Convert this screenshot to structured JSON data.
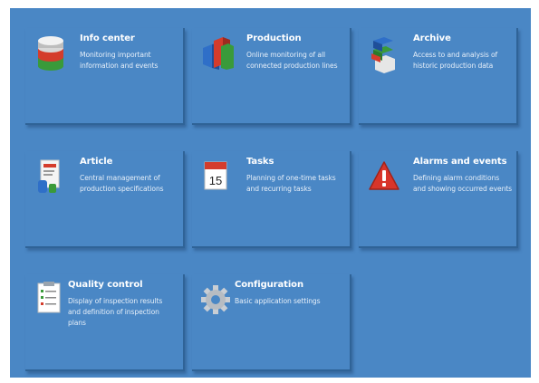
{
  "tiles": [
    {
      "id": "info-center",
      "title": "Info center",
      "desc": [
        "Monitoring important",
        "information and events"
      ],
      "icon": "database-icon"
    },
    {
      "id": "production",
      "title": "Production",
      "desc": [
        "Online monitoring of all",
        "connected production lines"
      ],
      "icon": "production-blocks-icon"
    },
    {
      "id": "archive",
      "title": "Archive",
      "desc": [
        "Access to and analysis of",
        "historic production data"
      ],
      "icon": "archive-stack-icon"
    },
    {
      "id": "article",
      "title": "Article",
      "desc": [
        "Central management of",
        "production specifications"
      ],
      "icon": "article-product-icon"
    },
    {
      "id": "tasks",
      "title": "Tasks",
      "desc": [
        "Planning of one-time tasks",
        "and recurring tasks"
      ],
      "icon": "calendar-icon",
      "calendar_day": "15"
    },
    {
      "id": "alarms-and-events",
      "title": "Alarms and events",
      "desc": [
        "Defining alarm conditions",
        "and showing occurred events"
      ],
      "icon": "warning-icon"
    },
    {
      "id": "quality-control",
      "title": "Quality control",
      "desc": [
        "Display of inspection results",
        "and definition of inspection",
        "plans"
      ],
      "icon": "checklist-icon"
    },
    {
      "id": "configuration",
      "title": "Configuration",
      "desc": [
        "Basic application settings"
      ],
      "icon": "gear-icon"
    }
  ]
}
